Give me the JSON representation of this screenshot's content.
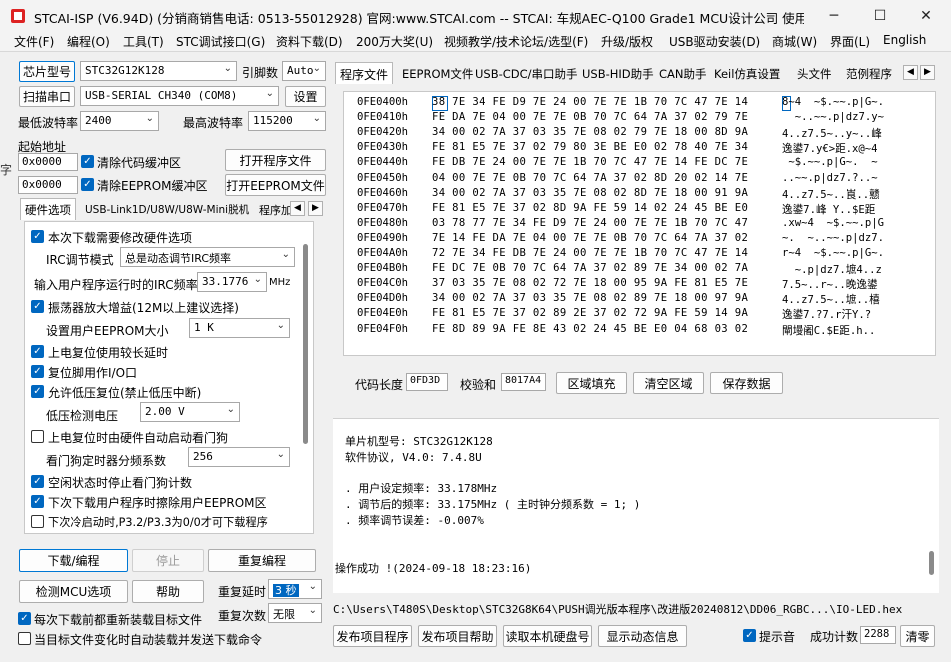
{
  "window": {
    "title": "STCAI-ISP (V6.94D) (分销商销售电话: 0513-55012928) 官网:www.STCAI.com  -- STCAI: 车规AEC-Q100 Grade1 MCU设计公司 使用本司芯片或采...",
    "minimize": "─",
    "maximize": "☐",
    "close": "✕"
  },
  "menu": [
    "文件(F)",
    "编程(O)",
    "工具(T)",
    "STC调试接口(G)",
    "资料下载(D)",
    "200万大奖(U)",
    "视频教学/技术论坛/选型(F)",
    "升级/版权",
    "USB驱动安装(D)",
    "商城(W)",
    "界面(L)",
    "English"
  ],
  "left": {
    "chip_type_label": "芯片型号",
    "chip_type_value": "STC32G12K128",
    "pin_label": "引脚数",
    "pin_value": "Auto",
    "scan_port_button": "扫描串口",
    "port_value": "USB-SERIAL CH340 (COM8)",
    "settings_button": "设置",
    "min_baud_label": "最低波特率",
    "min_baud_value": "2400",
    "max_baud_label": "最高波特率",
    "max_baud_value": "115200",
    "start_addr_label": "起始地址",
    "code_addr_value": "0x0000",
    "clear_code_buffer": "清除代码缓冲区",
    "open_program_button": "打开程序文件",
    "eeprom_addr_value": "0x0000",
    "clear_eeprom_buffer": "清除EEPROM缓冲区",
    "open_eeprom_button": "打开EEPROM文件",
    "side_text": "字"
  },
  "hw_tabs": [
    "硬件选项",
    "USB-Link1D/U8W/U8W-Mini脱机",
    "程序加"
  ],
  "hw": {
    "modify_hw": "本次下载需要修改硬件选项",
    "irc_mode_label": "IRC调节模式",
    "irc_mode_value": "总是动态调节IRC频率",
    "irc_freq_label": "输入用户程序运行时的IRC频率",
    "irc_freq_value": "33.1776",
    "irc_freq_unit": "MHz",
    "osc_gain": "振荡器放大增益(12M以上建议选择)",
    "eeprom_size_label": "设置用户EEPROM大小",
    "eeprom_size_value": "1   K",
    "long_delay": "上电复位使用较长延时",
    "reset_pin_io": "复位脚用作I/O口",
    "allow_lvr": "允许低压复位(禁止低压中断)",
    "lvd_label": "低压检测电压",
    "lvd_value": "2.00 V",
    "auto_wdt": "上电复位时由硬件自动启动看门狗",
    "wdt_div_label": "看门狗定时器分频系数",
    "wdt_div_value": "256",
    "idle_stop_wdt": "空闲状态时停止看门狗计数",
    "erase_eeprom": "下次下载用户程序时擦除用户EEPROM区",
    "cold_start": "下次冷启动时,P3.2/P3.3为0/0才可下载程序"
  },
  "bottom_left": {
    "download_button": "下载/编程",
    "stop_button": "停止",
    "repeat_button": "重复编程",
    "detect_button": "检测MCU选项",
    "help_button": "帮助",
    "repeat_delay_label": "重复延时",
    "repeat_delay_value": "3 秒",
    "repeat_count_label": "重复次数",
    "repeat_count_value": "无限",
    "reload_before": "每次下载前都重新装载目标文件",
    "auto_on_change": "当目标文件变化时自动装载并发送下载命令"
  },
  "right_tabs": [
    "程序文件",
    "EEPROM文件",
    "USB-CDC/串口助手",
    "USB-HID助手",
    "CAN助手",
    "Keil仿真设置",
    "头文件",
    "范例程序"
  ],
  "hex_rows": [
    {
      "addr": "0FE0400h",
      "bytes": "38 7E 34 FE D9 7E 24 00 7E 7E 1B 70 7C 47 7E 14",
      "ascii": "8~4  ~$.~~.p|G~."
    },
    {
      "addr": "0FE0410h",
      "bytes": "FE DA 7E 04 00 7E 7E 0B 70 7C 64 7A 37 02 79 7E",
      "ascii": "  ~..~~.p|dz7.y~"
    },
    {
      "addr": "0FE0420h",
      "bytes": "34 00 02 7A 37 03 35 7E 08 02 79 7E 18 00 8D 9A",
      "ascii": "4..z7.5~..y~..峰"
    },
    {
      "addr": "0FE0430h",
      "bytes": "FE 81 E5 7E 37 02 79 80 3E BE E0 02 78 40 7E 34",
      "ascii": "逸鍙7.y€>距.x@~4"
    },
    {
      "addr": "0FE0440h",
      "bytes": "FE DB 7E 24 00 7E 7E 1B 70 7C 47 7E 14 FE DC 7E",
      "ascii": " ~$.~~.p|G~.  ~"
    },
    {
      "addr": "0FE0450h",
      "bytes": "04 00 7E 7E 0B 70 7C 64 7A 37 02 8D 20 02 14 7E",
      "ascii": "..~~.p|dz7.?..~"
    },
    {
      "addr": "0FE0460h",
      "bytes": "34 00 02 7A 37 03 35 7E 08 02 8D 7E 18 00 91 9A",
      "ascii": "4..z7.5~..崀..戆"
    },
    {
      "addr": "0FE0470h",
      "bytes": "FE 81 E5 7E 37 02 8D 9A FE 59 14 02 24 45 BE E0",
      "ascii": "逸鍙7.峰 Y..$E距"
    },
    {
      "addr": "0FE0480h",
      "bytes": "03 78 77 7E 34 FE D9 7E 24 00 7E 7E 1B 70 7C 47",
      "ascii": ".xw~4  ~$.~~.p|G"
    },
    {
      "addr": "0FE0490h",
      "bytes": "7E 14 FE DA 7E 04 00 7E 7E 0B 70 7C 64 7A 37 02",
      "ascii": "~.  ~..~~.p|dz7."
    },
    {
      "addr": "0FE04A0h",
      "bytes": "72 7E 34 FE DB 7E 24 00 7E 7E 1B 70 7C 47 7E 14",
      "ascii": "r~4  ~$.~~.p|G~."
    },
    {
      "addr": "0FE04B0h",
      "bytes": "FE DC 7E 0B 70 7C 64 7A 37 02 89 7E 34 00 02 7A",
      "ascii": "  ~.p|dz7.墌4..z"
    },
    {
      "addr": "0FE04C0h",
      "bytes": "37 03 35 7E 08 02 72 7E 18 00 95 9A FE 81 E5 7E",
      "ascii": "7.5~..r~..晚逸鍙"
    },
    {
      "addr": "0FE04D0h",
      "bytes": "34 00 02 7A 37 03 35 7E 08 02 89 7E 18 00 97 9A",
      "ascii": "4..z7.5~..墌..橲"
    },
    {
      "addr": "0FE04E0h",
      "bytes": "FE 81 E5 7E 37 02 89 2E 37 02 72 9A FE 59 14 9A",
      "ascii": "逸鍙7.?7.r汗Y.?"
    },
    {
      "addr": "0FE04F0h",
      "bytes": "FE 8D 89 9A FE 8E 43 02 24 45 BE E0 04 68 03 02",
      "ascii": "閘墁阇C.$E距.h.."
    }
  ],
  "code_info": {
    "code_len_label": "代码长度",
    "code_len_value": "0FD3D",
    "checksum_label": "校验和",
    "checksum_value": "8017A4",
    "fill_button": "区域填充",
    "clear_button": "清空区域",
    "save_button": "保存数据"
  },
  "log": [
    "单片机型号: STC32G12K128",
    "软件协议, V4.0: 7.4.8U",
    "",
    ". 用户设定频率: 33.178MHz",
    ". 调节后的频率: 33.175MHz ( 主时钟分频系数 = 1; )",
    ". 频率调节误差: -0.007%",
    "",
    "",
    "",
    "操作成功 !(2024-09-18 18:23:16)"
  ],
  "file_path": "C:\\Users\\T480S\\Desktop\\STC32G8K64\\PUSH调光版本程序\\改进版20240812\\DD06_RGBC...\\IO-LED.hex",
  "bottom_right": {
    "publish_program": "发布项目程序",
    "publish_help": "发布项目帮助",
    "read_serial": "读取本机硬盘号",
    "show_dynamic": "显示动态信息",
    "beep_label": "提示音",
    "success_label": "成功计数",
    "success_value": "2288",
    "clear_button": "清零"
  },
  "colors": {
    "accent": "#0067c0",
    "primary_border": "#0078d4"
  }
}
